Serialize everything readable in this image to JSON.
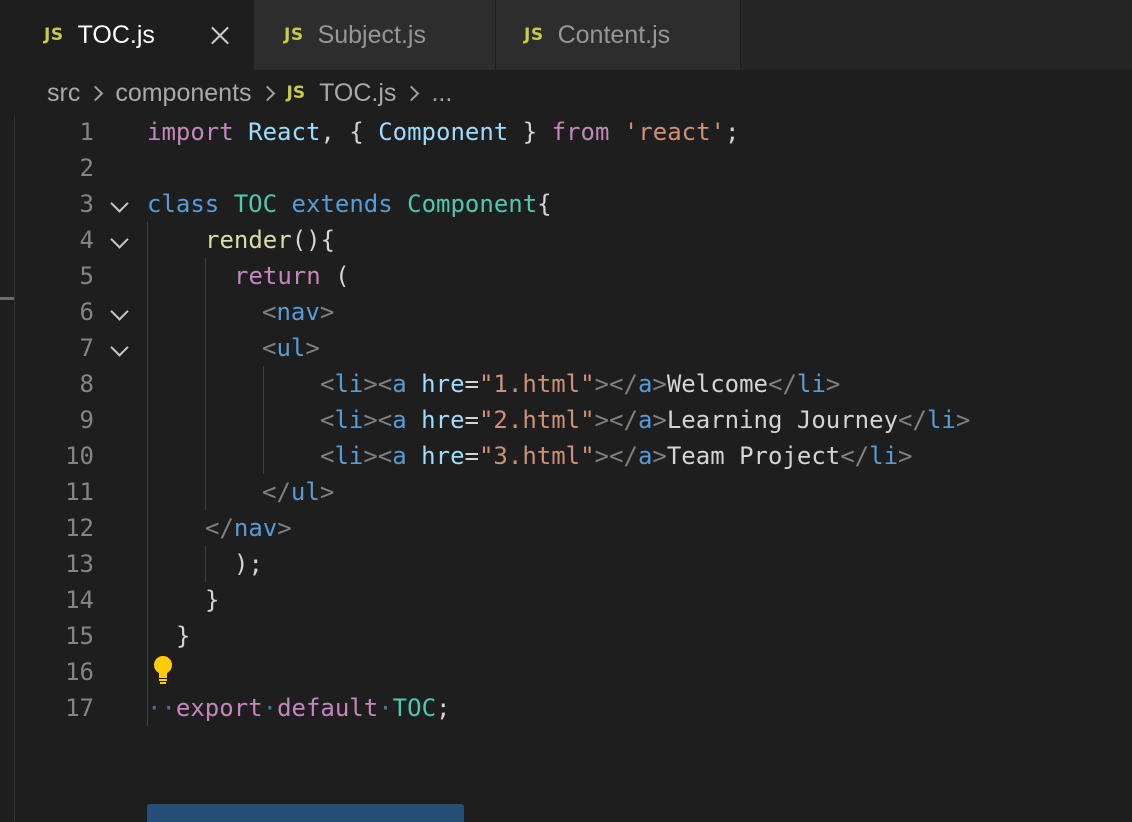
{
  "tabs": [
    {
      "icon": "JS",
      "label": "TOC.js",
      "active": true
    },
    {
      "icon": "JS",
      "label": "Subject.js",
      "active": false
    },
    {
      "icon": "JS",
      "label": "Content.js",
      "active": false
    }
  ],
  "breadcrumb": {
    "items": [
      "src",
      "components",
      "TOC.js",
      "..."
    ],
    "file_icon": "JS"
  },
  "editor": {
    "line_numbers": [
      "1",
      "2",
      "3",
      "4",
      "5",
      "6",
      "7",
      "8",
      "9",
      "10",
      "11",
      "12",
      "13",
      "14",
      "15",
      "16",
      "17"
    ],
    "lines": {
      "l1": {
        "kw_import": "import",
        "react": "React",
        "brace_open": ", { ",
        "component": "Component",
        "brace_close": " } ",
        "kw_from": "from",
        "module": "'react'",
        "semi": ";"
      },
      "l3": {
        "kw_class": "class",
        "name": "TOC",
        "kw_extends": "extends",
        "base": "Component",
        "brace": "{"
      },
      "l4": {
        "method": "render",
        "rest": "(){"
      },
      "l5": {
        "kw_return": "return",
        "paren": " ("
      },
      "l6": {
        "lt": "<",
        "tag": "nav",
        "gt": ">"
      },
      "l7": {
        "lt": "<",
        "tag": "ul",
        "gt": ">"
      },
      "l8": {
        "li_open": "li",
        "a_open": "a",
        "attr": "hre",
        "eq": "=",
        "href": "\"1.html\"",
        "a_close": "a",
        "text": "Welcome",
        "li_close": "li"
      },
      "l9": {
        "li_open": "li",
        "a_open": "a",
        "attr": "hre",
        "eq": "=",
        "href": "\"2.html\"",
        "a_close": "a",
        "text": "Learning Journey",
        "li_close": "li"
      },
      "l10": {
        "li_open": "li",
        "a_open": "a",
        "attr": "hre",
        "eq": "=",
        "href": "\"3.html\"",
        "a_close": "a",
        "text": "Team Project",
        "li_close": "li"
      },
      "l11": {
        "lt": "</",
        "tag": "ul",
        "gt": ">"
      },
      "l12": {
        "lt": "</",
        "tag": "nav",
        "gt": ">"
      },
      "l13": {
        "text": ");"
      },
      "l14": {
        "text": "}"
      },
      "l15": {
        "text": "}"
      },
      "l17": {
        "ws1": "·",
        "ws2": "·",
        "kw_export": "export",
        "ws3": "·",
        "kw_default": "default",
        "ws4": "·",
        "name": "TOC",
        "semi": ";"
      }
    },
    "lightbulb_icon": "lightbulb-icon",
    "selection_color": "#264f78"
  },
  "colors": {
    "background": "#1e1e1e",
    "keyword": "#c586c0",
    "storage": "#569cd6",
    "type": "#4ec9b0",
    "function": "#dcdcaa",
    "string": "#ce9178",
    "js_icon": "#cbcb41"
  }
}
